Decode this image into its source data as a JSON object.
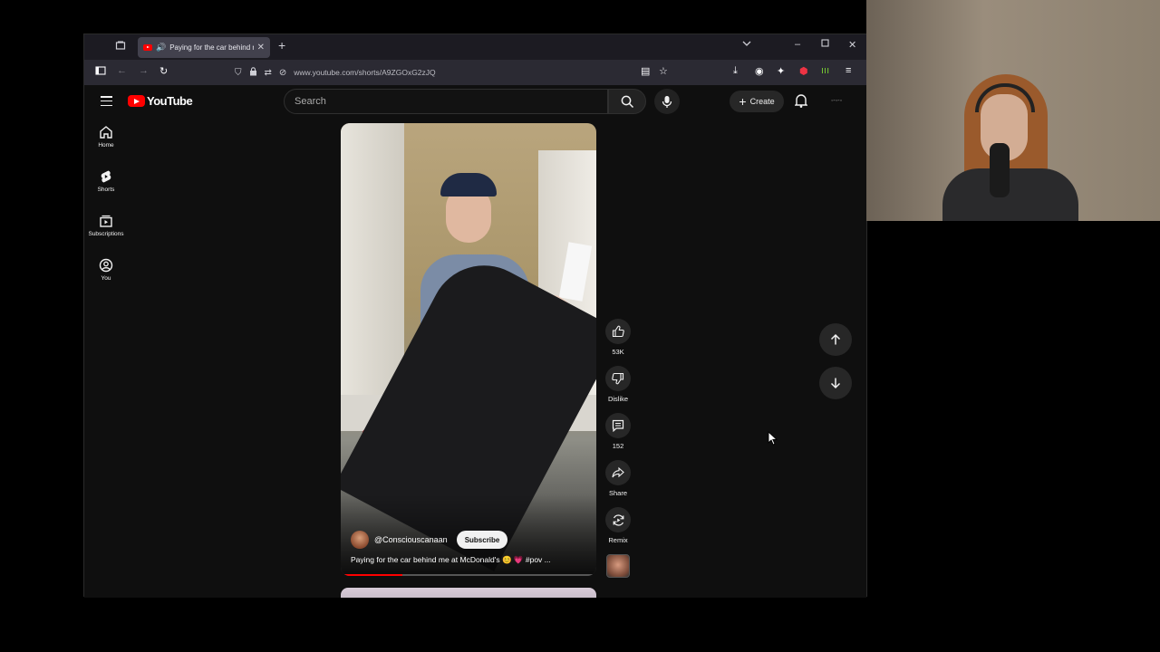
{
  "browser": {
    "tab_title": "Paying for the car behind me",
    "url": "www.youtube.com/shorts/A9ZGOxG2zJQ"
  },
  "youtube": {
    "logo_text": "YouTube",
    "search_placeholder": "Search",
    "create_label": "Create",
    "sidebar": [
      {
        "label": "Home",
        "icon": "home-icon"
      },
      {
        "label": "Shorts",
        "icon": "shorts-icon"
      },
      {
        "label": "Subscriptions",
        "icon": "subscriptions-icon"
      },
      {
        "label": "You",
        "icon": "you-icon"
      }
    ]
  },
  "short": {
    "channel": "@Consciouscanaan",
    "subscribe_label": "Subscribe",
    "caption": "Paying for the car behind me at McDonald's 😊 💗 #pov ...",
    "progress_fraction": 0.24,
    "actions": {
      "like_count": "53K",
      "dislike_label": "Dislike",
      "comment_count": "152",
      "share_label": "Share",
      "remix_label": "Remix"
    }
  },
  "colors": {
    "yt_red": "#ff0000",
    "yt_bg": "#0f0f0f",
    "button_bg": "#272727"
  }
}
